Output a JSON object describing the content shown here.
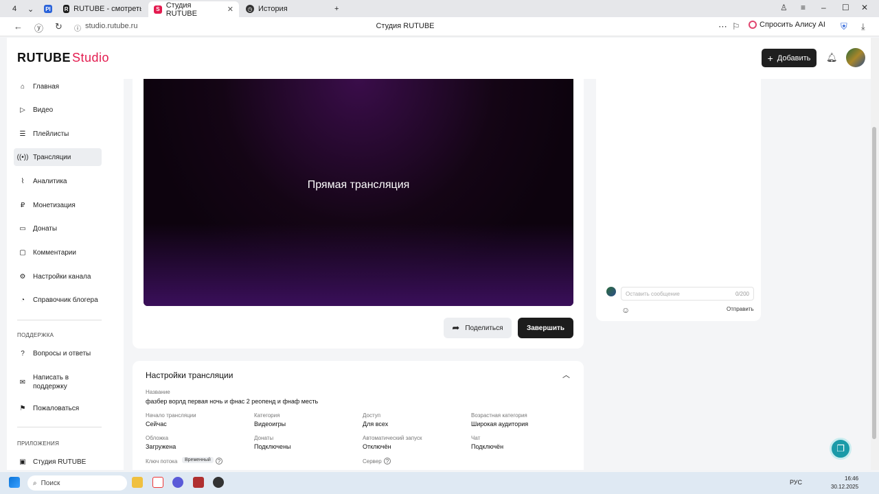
{
  "browser": {
    "tab_counter": "4",
    "tabs": [
      {
        "label": "RUTUBE - смотреть виде"
      },
      {
        "label": "Студия RUTUBE"
      },
      {
        "label": "История"
      }
    ],
    "url": "studio.rutube.ru",
    "page_title": "Студия RUTUBE",
    "alice_label": "Спросить Алису AI"
  },
  "header": {
    "logo_main": "RUTUBE",
    "logo_studio": "Studio",
    "add_label": "Добавить"
  },
  "sidebar": {
    "items": [
      {
        "label": "Главная"
      },
      {
        "label": "Видео"
      },
      {
        "label": "Плейлисты"
      },
      {
        "label": "Трансляции"
      },
      {
        "label": "Аналитика"
      },
      {
        "label": "Монетизация"
      },
      {
        "label": "Донаты"
      },
      {
        "label": "Комментарии"
      },
      {
        "label": "Настройки канала"
      },
      {
        "label": "Справочник блогера"
      }
    ],
    "support_title": "ПОДДЕРЖКА",
    "support_items": [
      {
        "label": "Вопросы и ответы"
      },
      {
        "label": "Написать в поддержку"
      },
      {
        "label": "Пожаловаться"
      }
    ],
    "apps_title": "ПРИЛОЖЕНИЯ",
    "apps_items": [
      {
        "label": "Студия RUTUBE"
      }
    ]
  },
  "player": {
    "live_title": "Прямая трансляция",
    "share_label": "Поделиться",
    "end_label": "Завершить"
  },
  "chat": {
    "placeholder": "Оставить сообщение",
    "counter": "0/200",
    "send_label": "Отправить"
  },
  "settings": {
    "title": "Настройки трансляции",
    "name_label": "Название",
    "name_value": "фазбер ворлд первая ночь и фнас 2 реопенд и фнаф месть",
    "fields": [
      {
        "label": "Начало трансляции",
        "value": "Сейчас"
      },
      {
        "label": "Категория",
        "value": "Видеоигры"
      },
      {
        "label": "Доступ",
        "value": "Для всех"
      },
      {
        "label": "Возрастная категория",
        "value": "Широкая аудитория"
      },
      {
        "label": "Обложка",
        "value": "Загружена"
      },
      {
        "label": "Донаты",
        "value": "Подключены"
      },
      {
        "label": "Автоматический запуск",
        "value": "Отключён"
      },
      {
        "label": "Чат",
        "value": "Подключён"
      }
    ],
    "stream_key_label": "Ключ потока",
    "stream_key_badge": "Временный",
    "server_label": "Сервер"
  },
  "taskbar": {
    "search_label": "Поиск",
    "lang": "РУС",
    "time": "16:46",
    "date": "30.12.2025"
  },
  "colors": {
    "accent": "#e31b4f",
    "dark_button": "#1c1c1c",
    "help_fab": "#1a9aa8"
  }
}
